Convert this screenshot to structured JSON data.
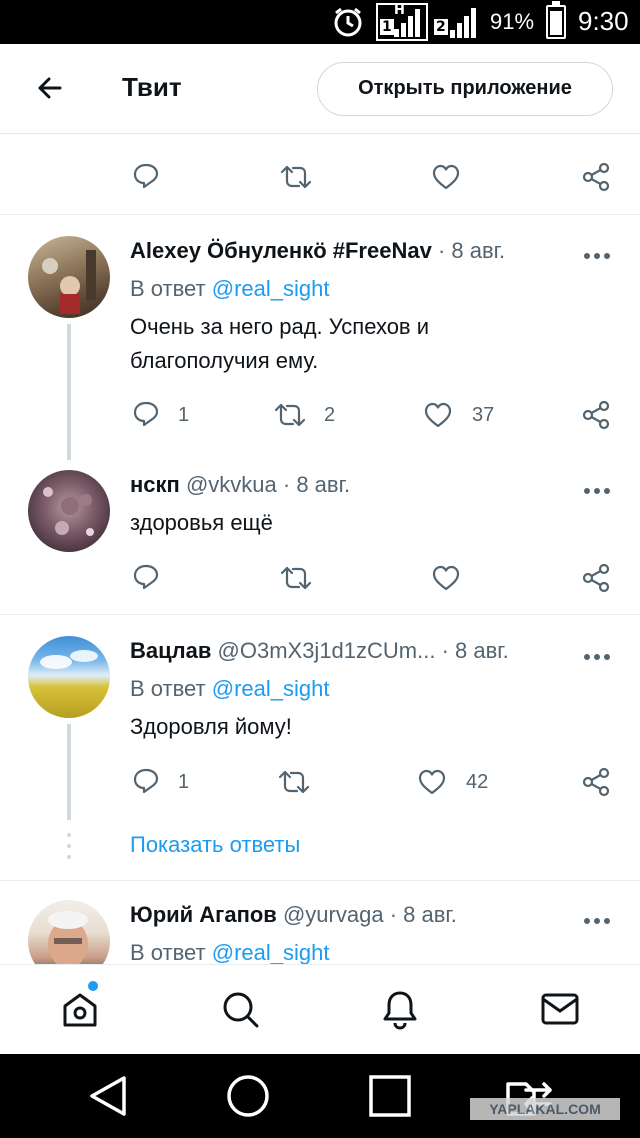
{
  "status_bar": {
    "sim1_label": "H",
    "sim1_index": "1",
    "sim2_index": "2",
    "battery_percent": "91%",
    "battery_level": 0.91,
    "time": "9:30"
  },
  "header": {
    "title": "Твит",
    "open_app_label": "Открыть приложение"
  },
  "tweets": [
    {
      "name": "Alexey Öбнуленкö #FreeNav",
      "handle": "",
      "date": "· 8 авг.",
      "reply_prefix": "В ответ ",
      "reply_to": "@real_sight",
      "text": "Очень за него рад. Успехов и благополучия ему.",
      "replies": "1",
      "retweets": "2",
      "likes": "37"
    },
    {
      "name": "нскп",
      "handle": "@vkvkua",
      "date": "· 8 авг.",
      "text": "здоровья ещё",
      "replies": "",
      "retweets": "",
      "likes": ""
    },
    {
      "name": "Вацлав",
      "handle": "@O3mX3j1d1zCUm...",
      "date": "· 8 авг.",
      "reply_prefix": "В ответ ",
      "reply_to": "@real_sight",
      "text": "Здоровля йому!",
      "replies": "1",
      "retweets": "",
      "likes": "42"
    },
    {
      "name": "Юрий Агапов",
      "handle": "@yurvaga",
      "date": "· 8 авг.",
      "reply_prefix": "В ответ ",
      "reply_to": "@real_sight"
    }
  ],
  "show_replies_label": "Показать ответы",
  "tabs": [
    "home-icon",
    "search-icon",
    "bell-icon",
    "mail-icon"
  ],
  "watermark": "YAPLAKAL.COM",
  "colors": {
    "link": "#1d9bf0",
    "secondary": "#536471",
    "notification_dot": "#1d9bf0"
  }
}
